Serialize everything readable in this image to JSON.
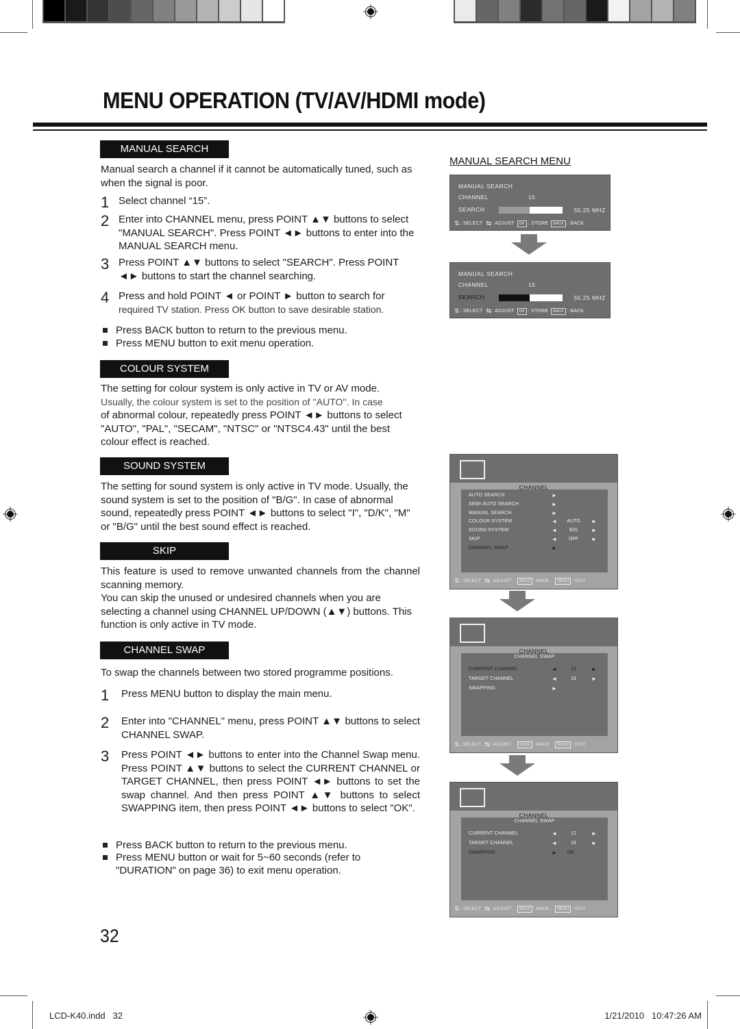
{
  "print_marks": {
    "left_swatches": [
      "#000000",
      "#1a1a1a",
      "#333333",
      "#4d4d4d",
      "#666666",
      "#808080",
      "#999999",
      "#b3b3b3",
      "#cccccc",
      "#e6e6e6",
      "#ffffff"
    ],
    "right_swatches": [
      "#ebebeb",
      "#666666",
      "#808080",
      "#2b2b2b",
      "#737373",
      "#666666",
      "#1a1a1a",
      "#f2f2f2",
      "#a3a3a3",
      "#b3b3b3",
      "#808080"
    ],
    "registration_icon": "crosshair-target-icon"
  },
  "page": {
    "title": "MENU OPERATION (TV/AV/HDMI mode)",
    "number": "32",
    "footer_file": "LCD-K40.indd   32",
    "footer_timestamp": "1/21/2010   10:47:26 AM"
  },
  "sections": {
    "manual_search": {
      "header": "MANUAL SEARCH",
      "intro": "Manual search a channel if it cannot be automatically tuned, such as when the signal is poor.",
      "steps": [
        {
          "num": "1",
          "text": "Select channel “15”."
        },
        {
          "num": "2",
          "text": "Enter into CHANNEL menu, press POINT ▲▼ buttons to select \"MANUAL SEARCH\". Press POINT ◄► buttons to enter into the MANUAL SEARCH menu."
        },
        {
          "num": "3",
          "text": "Press POINT ▲▼ buttons to select \"SEARCH\". Press POINT ◄► buttons to start the channel searching."
        },
        {
          "num": "4",
          "text_main": "Press and hold POINT ◄ or POINT ► button to search for",
          "text_small": "required  TV station. Press OK button to save desirable station."
        }
      ],
      "bullets": [
        "Press BACK button to return to the previous menu.",
        "Press MENU button to exit menu operation."
      ]
    },
    "colour_system": {
      "header": "COLOUR SYSTEM",
      "line1": "The setting for colour system is only active in TV or AV mode.",
      "line2": "Usually, the colour system is set to the position of ''AUTO''. In case",
      "rest": "of abnormal colour, repeatedly press POINT ◄► buttons to select \"AUTO\", \"PAL\", \"SECAM\", \"NTSC\" or \"NTSC4.43\" until the best colour effect is reached."
    },
    "sound_system": {
      "header": "SOUND SYSTEM",
      "text": "The setting for sound system is only active in TV mode. Usually, the sound system is set to the position of \"B/G\". In case of abnormal sound, repeatedly press POINT ◄► buttons to select \"I\", \"D/K\", \"M\" or \"B/G\" until the best sound effect is reached."
    },
    "skip": {
      "header": "SKIP",
      "text1": "This feature is used to remove unwanted channels from the channel scanning memory.",
      "text2": "You can skip the unused or undesired channels when you are selecting a channel using CHANNEL UP/DOWN (▲▼) buttons. This function is only active in TV mode."
    },
    "channel_swap": {
      "header": "CHANNEL SWAP",
      "intro": "To swap the channels between two stored programme positions.",
      "steps": [
        {
          "num": "1",
          "text": "Press MENU button to display the main menu."
        },
        {
          "num": "2",
          "text": "Enter into \"CHANNEL\" menu, press POINT ▲▼ buttons to select CHANNEL SWAP."
        },
        {
          "num": "3",
          "text": "Press POINT ◄► buttons to enter into the Channel Swap menu. Press POINT ▲▼ buttons to select the CURRENT CHANNEL or TARGET CHANNEL, then press POINT ◄► buttons to set the swap channel. And then press POINT ▲▼ buttons to select SWAPPING item, then press POINT ◄► buttons to select \"OK\"."
        }
      ],
      "bullets": [
        "Press BACK button to return to the previous menu.",
        "Press MENU button or wait for 5~60 seconds (refer to \"DURATION\" on page 36) to exit menu operation."
      ]
    }
  },
  "manual_search_menu": {
    "caption": "MANUAL SEARCH  MENU",
    "screens": [
      {
        "title": "MANUAL SEARCH",
        "channel_label": "CHANNEL",
        "channel_value": "15",
        "search_label": "SEARCH",
        "progress_percent": 48,
        "bar_fill_color": "#9a9a9a",
        "frequency": "55.25  MHZ"
      },
      {
        "title": "MANUAL SEARCH",
        "channel_label": "CHANNEL",
        "channel_value": "15",
        "search_label": "SEARCH",
        "progress_percent": 48,
        "bar_fill_color": "#111111",
        "frequency": "55.25  MHZ"
      }
    ],
    "legend": {
      "select": ": SELECT",
      "adjust": ": ADJUST",
      "ok_key": "OK",
      "store": ": STORE",
      "back_key": "BACK",
      "back": ": BACK"
    }
  },
  "channel_menu": {
    "title": "CHANNEL",
    "items": [
      {
        "label": "AUTO SEARCH",
        "left_arrow": "",
        "value": "",
        "right_arrow": "►"
      },
      {
        "label": "SEMI-AUTO SEARCH",
        "left_arrow": "",
        "value": "",
        "right_arrow": "►"
      },
      {
        "label": "MANUAL SEARCH",
        "left_arrow": "",
        "value": "",
        "right_arrow": "►"
      },
      {
        "label": "COLOUR SYSTEM",
        "left_arrow": "◄",
        "value": "AUTO",
        "right_arrow": "►"
      },
      {
        "label": "SOUND SYSTEM",
        "left_arrow": "◄",
        "value": "B/G",
        "right_arrow": "►"
      },
      {
        "label": "SKIP",
        "left_arrow": "◄",
        "value": "OFF",
        "right_arrow": "►"
      },
      {
        "label": "CHANNEL SWAP",
        "left_arrow": "",
        "value": "",
        "right_arrow": "►",
        "selected": true
      }
    ],
    "legend": {
      "select": ": SELECT",
      "adjust": ": ADJUST",
      "back_key": "BACK",
      "back": ": BACK",
      "menu_key": "MENU",
      "exit": ": EXIT"
    }
  },
  "channel_swap_menu": {
    "title": "CHANNEL",
    "subtitle": "CHANNEL SWAP",
    "screens": [
      {
        "items": [
          {
            "label": "CURRENT CHANNEL",
            "value": "12",
            "selected": true
          },
          {
            "label": "TARGET CHANNEL",
            "value": "16"
          },
          {
            "label": "SWAPPING",
            "value": ""
          }
        ]
      },
      {
        "items": [
          {
            "label": "CURRENT CHANNEL",
            "value": "12"
          },
          {
            "label": "TARGET CHANNEL",
            "value": "16"
          },
          {
            "label": "SWAPPING",
            "value": "OK",
            "selected": true
          }
        ]
      }
    ]
  }
}
